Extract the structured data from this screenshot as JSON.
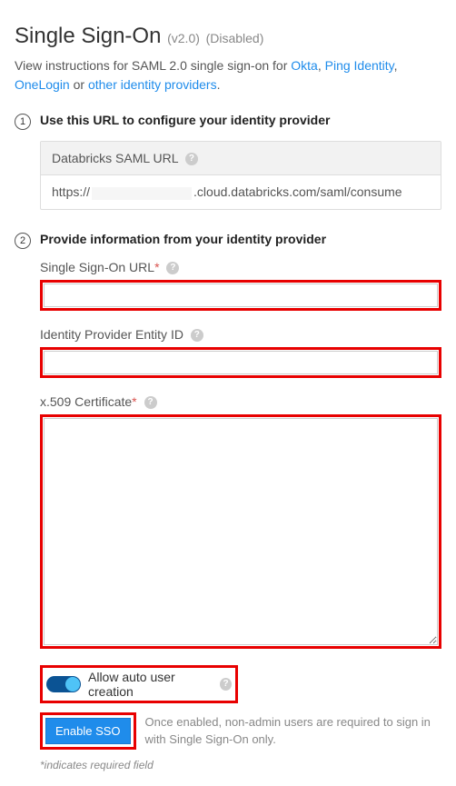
{
  "header": {
    "title": "Single Sign-On",
    "version": "(v2.0)",
    "status": "(Disabled)"
  },
  "intro": {
    "prefix": "View instructions for SAML 2.0 single sign-on for ",
    "links": {
      "okta": "Okta",
      "ping": "Ping Identity",
      "onelogin": "OneLogin",
      "other": "other identity providers"
    },
    "or": " or "
  },
  "step1": {
    "num": "1",
    "title": "Use this URL to configure your identity provider",
    "box_header": "Databricks SAML URL",
    "url_prefix": "https://",
    "url_suffix": ".cloud.databricks.com/saml/consume"
  },
  "step2": {
    "num": "2",
    "title": "Provide information from your identity provider",
    "sso_url_label": "Single Sign-On URL",
    "entity_id_label": "Identity Provider Entity ID",
    "cert_label": "x.509 Certificate"
  },
  "toggle": {
    "label": "Allow auto user creation"
  },
  "enable": {
    "button": "Enable SSO",
    "note": "Once enabled, non-admin users are required to sign in with Single Sign-On only."
  },
  "footer": {
    "required_note": "*indicates required field"
  },
  "symbols": {
    "star": "*",
    "help": "?"
  }
}
